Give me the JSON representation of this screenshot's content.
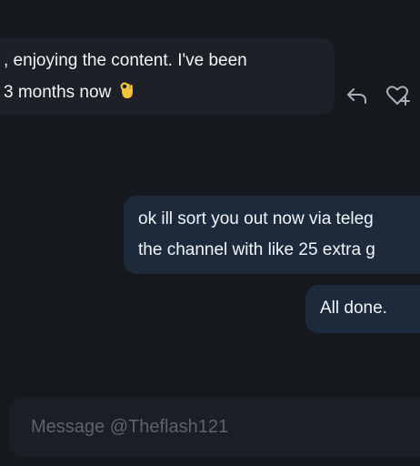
{
  "messages": [
    {
      "direction": "incoming",
      "lines": [
        ", enjoying the content. I've been",
        "3 months now"
      ],
      "emoji": "ok-hand"
    },
    {
      "direction": "outgoing",
      "lines": [
        "ok ill sort you out now via teleg",
        "the channel with like 25 extra g"
      ]
    },
    {
      "direction": "outgoing",
      "lines": [
        "All done."
      ]
    }
  ],
  "message_actions": {
    "icons": [
      "reply-icon",
      "heart-plus-icon"
    ]
  },
  "composer": {
    "placeholder": "Message @Theflash121",
    "value": ""
  },
  "colors": {
    "background": "#15181d",
    "incoming_bubble": "#1d2026",
    "outgoing_bubble": "#1c2a3b",
    "icon": "#aab0b9",
    "placeholder": "#5d626b"
  }
}
